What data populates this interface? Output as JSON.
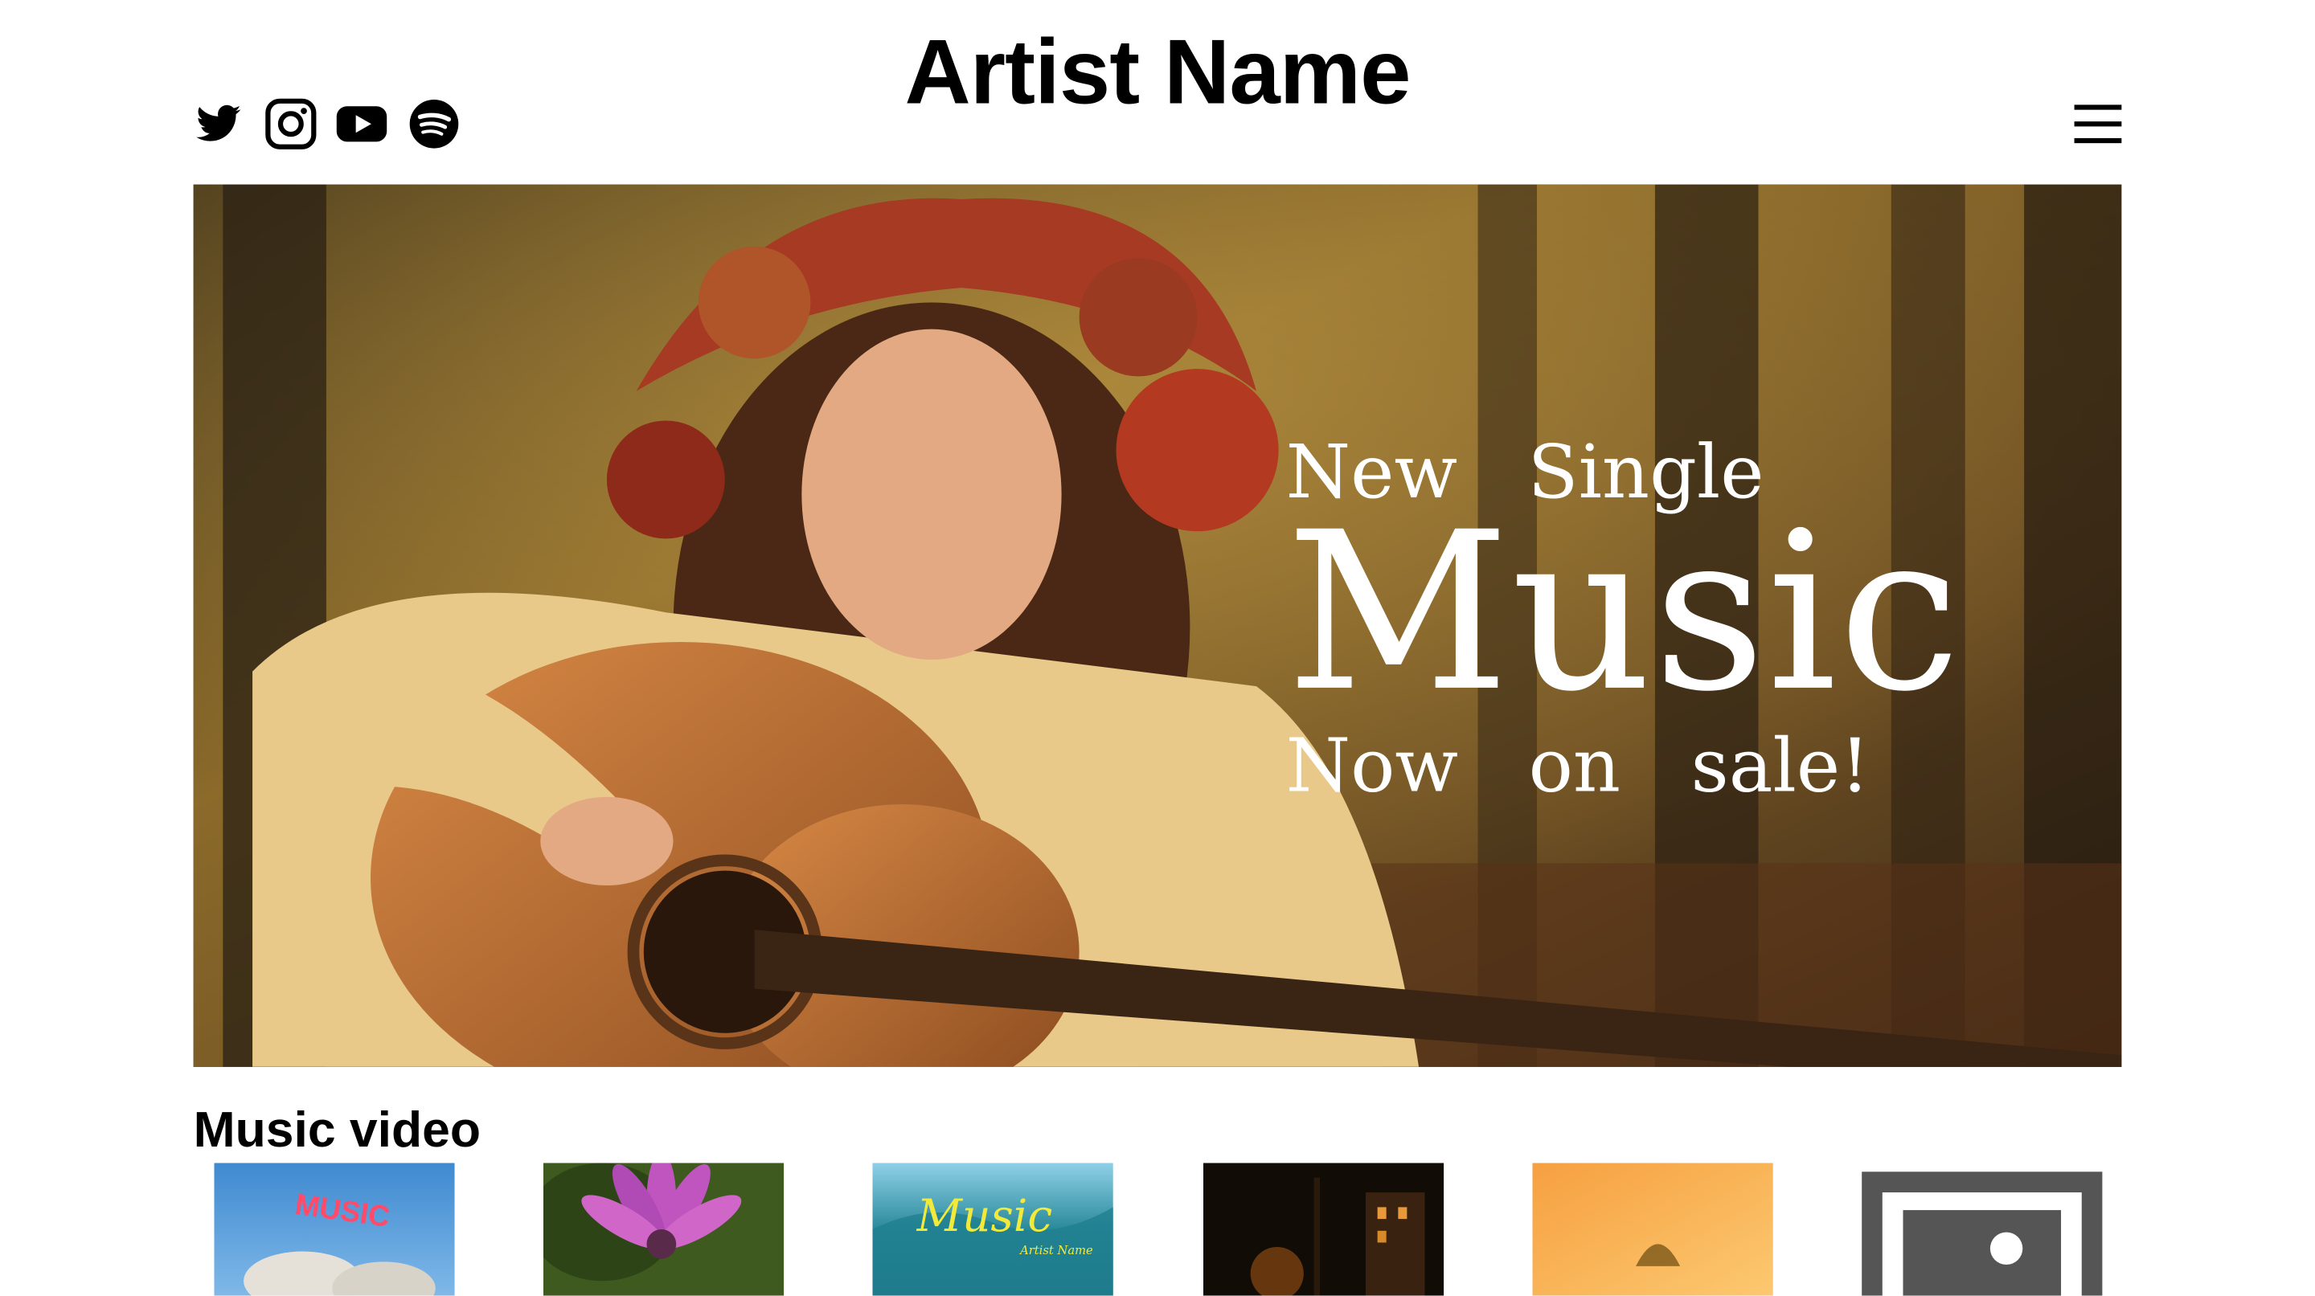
{
  "header": {
    "site_title": "Artist Name",
    "social_icons": [
      "twitter-icon",
      "instagram-icon",
      "youtube-icon",
      "spotify-icon"
    ],
    "menu_icon": "hamburger-menu-icon"
  },
  "hero": {
    "line1": "New   Single",
    "line2": "Music",
    "line3": "Now   on   sale!"
  },
  "music_video": {
    "section_title": "Music video",
    "thumbnails": [
      {
        "label": "MUSIC"
      },
      {
        "label": ""
      },
      {
        "label": "Music",
        "sublabel": "Artist Name"
      },
      {
        "label": ""
      },
      {
        "label": ""
      },
      {
        "label": ""
      }
    ]
  },
  "colors": {
    "text": "#000000",
    "background": "#ffffff",
    "hero_text": "#ffffff"
  }
}
